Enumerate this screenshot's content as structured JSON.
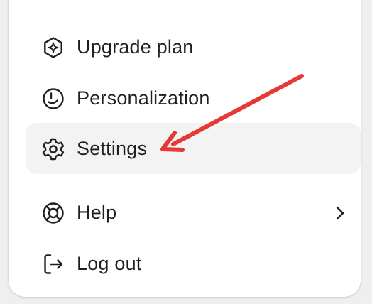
{
  "menu": {
    "items": [
      {
        "label": "Upgrade plan",
        "icon": "sparkle-hexagon-icon"
      },
      {
        "label": "Personalization",
        "icon": "personalization-icon"
      },
      {
        "label": "Settings",
        "icon": "gear-icon",
        "highlighted": true
      },
      {
        "label": "Help",
        "icon": "lifebuoy-icon",
        "has_submenu": true,
        "submenu_icon": "chevron-right-icon"
      },
      {
        "label": "Log out",
        "icon": "logout-icon"
      }
    ]
  },
  "annotation": {
    "type": "arrow",
    "color": "#e53935",
    "points_to": "Settings"
  },
  "colors": {
    "highlight": "#f3f3f3",
    "divider": "#e3e3e3",
    "text": "#1f1f1f"
  }
}
